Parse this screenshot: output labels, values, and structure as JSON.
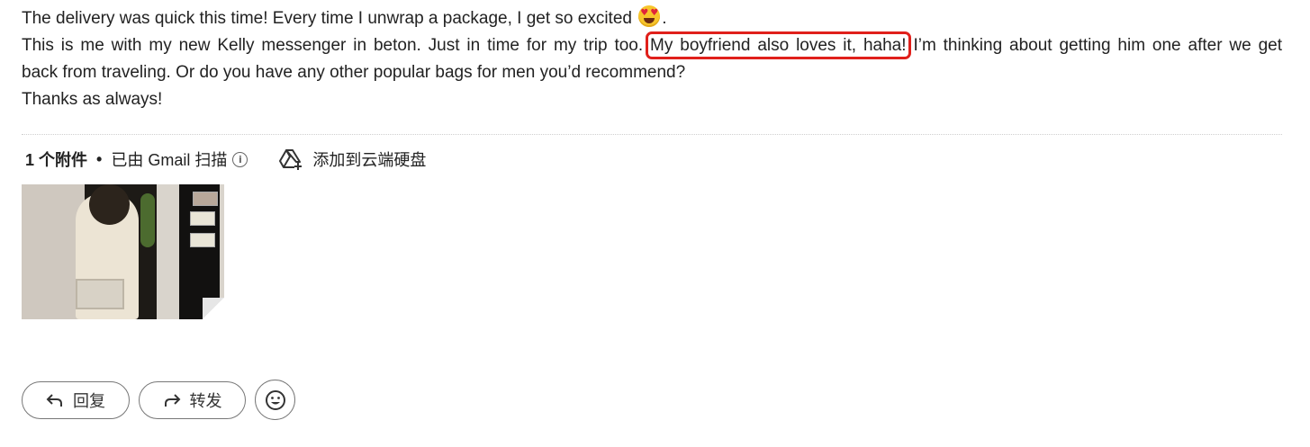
{
  "message": {
    "line1": "The delivery was quick this time! Every time I unwrap a package, I get so excited",
    "line1_end": ".",
    "line2_before": "This is me with my new Kelly messenger in beton. Just in time for my trip too.",
    "line2_highlight": "My boyfriend also loves it, haha!",
    "line2_after": "I’m thinking about getting him one after we get",
    "line3": "back from traveling. Or do you have any other popular bags for men you’d recommend?",
    "line4": "Thanks as always!"
  },
  "attachments": {
    "count_label": "1 个附件",
    "separator": "•",
    "scanned_label": "已由 Gmail 扫描",
    "info_icon": "i",
    "add_to_drive_label": "添加到云端硬盘"
  },
  "actions": {
    "reply_label": "回复",
    "forward_label": "转发"
  },
  "colors": {
    "highlight_box": "#e0201b",
    "text": "#222222"
  },
  "icons": {
    "emoji": "heart-eyes-emoji",
    "info": "info-icon",
    "drive": "drive-add-icon",
    "reply": "reply-icon",
    "forward": "forward-icon",
    "emoji_react": "smiley-icon"
  }
}
